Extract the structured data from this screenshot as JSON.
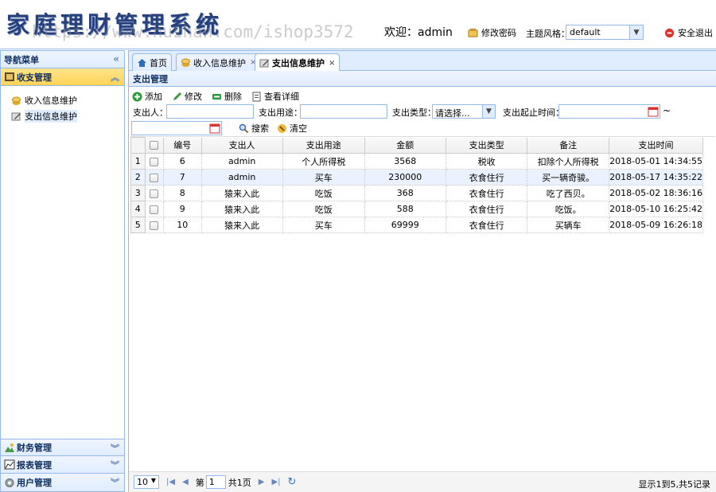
{
  "header": {
    "logo_text": "家庭理财管理系统",
    "watermark": "https://www.huzhan.com/ishop3572",
    "welcome": "欢迎：admin",
    "change_password": "修改密码",
    "theme_label": "主题风格：",
    "theme_value": "default",
    "logout": "安全退出"
  },
  "sidebar": {
    "title": "导航菜单",
    "groups": [
      {
        "label": "收支管理",
        "active": true
      },
      {
        "label": "财务管理"
      },
      {
        "label": "报表管理"
      },
      {
        "label": "用户管理"
      }
    ],
    "items": [
      {
        "label": "收入信息维护"
      },
      {
        "label": "支出信息维护",
        "selected": true
      }
    ]
  },
  "tabs": [
    {
      "label": "首页"
    },
    {
      "label": "收入信息维护"
    },
    {
      "label": "支出信息维护",
      "active": true
    }
  ],
  "panel": {
    "title": "支出管理",
    "toolbar": {
      "add": "添加",
      "edit": "修改",
      "delete": "删除",
      "detail": "查看详细"
    },
    "search": {
      "payer_label": "支出人：",
      "purpose_label": "支出用途：",
      "type_label": "支出类型：",
      "type_value": "请选择...",
      "time_label": "支出起止时间：",
      "tilde": "~",
      "search_btn": "搜索",
      "clear_btn": "清空"
    },
    "table": {
      "columns": [
        "编号",
        "支出人",
        "支出用途",
        "金额",
        "支出类型",
        "备注",
        "支出时间"
      ],
      "rows": [
        [
          "1",
          "6",
          "admin",
          "个人所得税",
          "3568",
          "税收",
          "扣除个人所得税",
          "2018-05-01 14:34:55"
        ],
        [
          "2",
          "7",
          "admin",
          "买车",
          "230000",
          "衣食住行",
          "买一辆奇骏。",
          "2018-05-17 14:35:22"
        ],
        [
          "3",
          "8",
          "猿来入此",
          "吃饭",
          "368",
          "衣食住行",
          "吃了西贝。",
          "2018-05-02 18:36:16"
        ],
        [
          "4",
          "9",
          "猿来入此",
          "吃饭",
          "588",
          "衣食住行",
          "吃饭。",
          "2018-05-10 16:25:42"
        ],
        [
          "5",
          "10",
          "猿来入此",
          "买车",
          "69999",
          "衣食住行",
          "买辆车",
          "2018-05-09 16:26:18"
        ]
      ]
    },
    "pager": {
      "page_size": "10",
      "page_prefix": "第",
      "page_value": "1",
      "page_suffix": "共1页",
      "info": "显示1到5,共5记录"
    }
  },
  "colors": {
    "border": "#95b8e7",
    "header_bg": "#e0ecff",
    "active_group": "#ffd455",
    "logo": "#27407b"
  }
}
